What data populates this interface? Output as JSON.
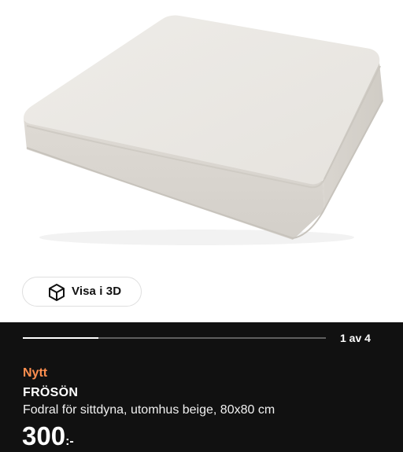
{
  "view_3d": {
    "label": "Visa i 3D",
    "icon": "cube-icon"
  },
  "gallery": {
    "counter": "1 av 4",
    "progress": 0.25
  },
  "product": {
    "badge": "Nytt",
    "name": "FRÖSÖN",
    "description": "Fodral för sittdyna, utomhus beige, 80x80 cm",
    "price_integer": "300",
    "price_suffix": ":-"
  },
  "colors": {
    "badge": "#ff8f4f",
    "panel": "#111111",
    "cushion": "#ebe8e3"
  }
}
